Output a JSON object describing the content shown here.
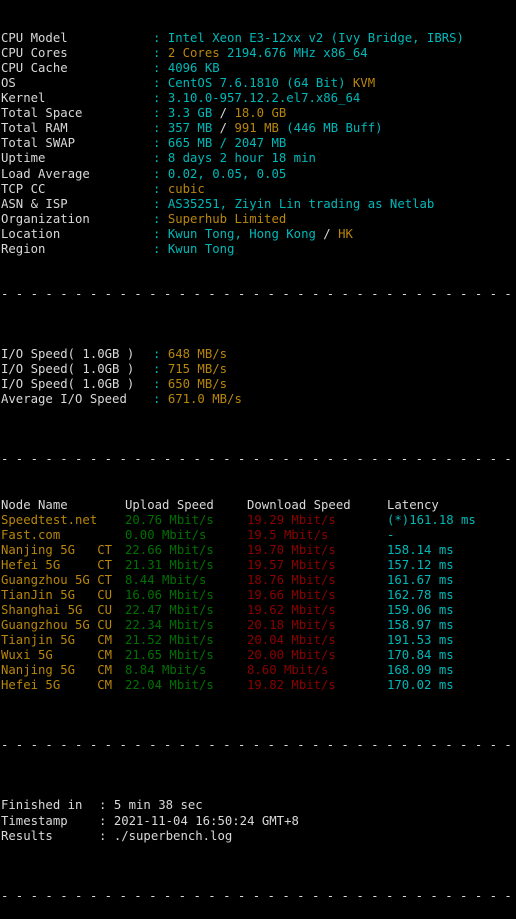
{
  "terminal": {
    "background": "#000000",
    "colors": {
      "white": "#d9d9d9",
      "cyan": "#00b8b8",
      "yellow": "#b8860b",
      "green": "#007000",
      "red": "#8b0000"
    },
    "separator": "----------------------------------------------------------------------"
  },
  "sysinfo": {
    "rows": [
      {
        "label": "CPU Model",
        "colon": ":",
        "value_primary": "Intel Xeon E3-12xx v2 (Ivy Bridge, IBRS)",
        "value_primary_color": "cyan",
        "value_secondary": "",
        "value_secondary_color": ""
      },
      {
        "label": "CPU Cores",
        "colon": ":",
        "value_primary": "2 Cores",
        "value_primary_color": "yellow",
        "value_secondary": "2194.676 MHz x86_64",
        "value_secondary_color": "cyan"
      },
      {
        "label": "CPU Cache",
        "colon": ":",
        "value_primary": "4096 KB",
        "value_primary_color": "cyan",
        "value_secondary": "",
        "value_secondary_color": ""
      },
      {
        "label": "OS",
        "colon": ":",
        "value_primary": "CentOS 7.6.1810 (64 Bit)",
        "value_primary_color": "cyan",
        "value_secondary": "KVM",
        "value_secondary_color": "yellow"
      },
      {
        "label": "Kernel",
        "colon": ":",
        "value_primary": "3.10.0-957.12.2.el7.x86_64",
        "value_primary_color": "cyan",
        "value_secondary": "",
        "value_secondary_color": ""
      },
      {
        "label": "Total Space",
        "colon": ":",
        "value_primary": "3.3 GB",
        "value_primary_color": "cyan",
        "value_secondary": "/ 18.0 GB",
        "value_secondary_color": "yellow"
      },
      {
        "label": "Total RAM",
        "colon": ":",
        "value_primary": "357 MB",
        "value_primary_color": "cyan",
        "value_secondary": "/ 991 MB (446 MB Buff)",
        "value_secondary_color": "yellow-cyan"
      },
      {
        "label": "Total SWAP",
        "colon": ":",
        "value_primary": "665 MB / 2047 MB",
        "value_primary_color": "cyan",
        "value_secondary": "",
        "value_secondary_color": ""
      },
      {
        "label": "Uptime",
        "colon": ":",
        "value_primary": "8 days 2 hour 18 min",
        "value_primary_color": "cyan",
        "value_secondary": "",
        "value_secondary_color": ""
      },
      {
        "label": "Load Average",
        "colon": ":",
        "value_primary": "0.02, 0.05, 0.05",
        "value_primary_color": "cyan",
        "value_secondary": "",
        "value_secondary_color": ""
      },
      {
        "label": "TCP CC",
        "colon": ":",
        "value_primary": "cubic",
        "value_primary_color": "yellow",
        "value_secondary": "",
        "value_secondary_color": ""
      },
      {
        "label": "ASN & ISP",
        "colon": ":",
        "value_primary": "AS35251, Ziyin Lin trading as Netlab",
        "value_primary_color": "cyan",
        "value_secondary": "",
        "value_secondary_color": ""
      },
      {
        "label": "Organization",
        "colon": ":",
        "value_primary": "Superhub Limited",
        "value_primary_color": "yellow",
        "value_secondary": "",
        "value_secondary_color": ""
      },
      {
        "label": "Location",
        "colon": ":",
        "value_primary": "Kwun Tong, Hong Kong",
        "value_primary_color": "cyan",
        "value_secondary": "/ HK",
        "value_secondary_color": "yellow"
      },
      {
        "label": "Region",
        "colon": ":",
        "value_primary": "Kwun Tong",
        "value_primary_color": "cyan",
        "value_secondary": "",
        "value_secondary_color": ""
      }
    ]
  },
  "io": {
    "rows": [
      {
        "label": "I/O Speed( 1.0GB )",
        "colon": ":",
        "value": "648 MB/s"
      },
      {
        "label": "I/O Speed( 1.0GB )",
        "colon": ":",
        "value": "715 MB/s"
      },
      {
        "label": "I/O Speed( 1.0GB )",
        "colon": ":",
        "value": "650 MB/s"
      },
      {
        "label": "Average I/O Speed",
        "colon": ":",
        "value": "671.0 MB/s"
      }
    ]
  },
  "speedtest": {
    "headers": {
      "node": "Node Name",
      "upload": "Upload Speed",
      "download": "Download Speed",
      "latency": "Latency"
    },
    "rows": [
      {
        "node": "Speedtest.net",
        "isp": "",
        "upload": "20.76 Mbit/s",
        "download": "19.29 Mbit/s",
        "latency": "(*)161.18 ms"
      },
      {
        "node": "Fast.com",
        "isp": "",
        "upload": "0.00 Mbit/s",
        "download": "19.5 Mbit/s",
        "latency": "-"
      },
      {
        "node": "Nanjing 5G",
        "isp": "CT",
        "upload": "22.66 Mbit/s",
        "download": "19.70 Mbit/s",
        "latency": "158.14 ms"
      },
      {
        "node": "Hefei 5G",
        "isp": "CT",
        "upload": "21.31 Mbit/s",
        "download": "19.57 Mbit/s",
        "latency": "157.12 ms"
      },
      {
        "node": "Guangzhou 5G",
        "isp": "CT",
        "upload": "8.44 Mbit/s",
        "download": "18.76 Mbit/s",
        "latency": "161.67 ms"
      },
      {
        "node": "TianJin 5G",
        "isp": "CU",
        "upload": "16.06 Mbit/s",
        "download": "19.66 Mbit/s",
        "latency": "162.78 ms"
      },
      {
        "node": "Shanghai 5G",
        "isp": "CU",
        "upload": "22.47 Mbit/s",
        "download": "19.62 Mbit/s",
        "latency": "159.06 ms"
      },
      {
        "node": "Guangzhou 5G",
        "isp": "CU",
        "upload": "22.34 Mbit/s",
        "download": "20.18 Mbit/s",
        "latency": "158.97 ms"
      },
      {
        "node": "Tianjin 5G",
        "isp": "CM",
        "upload": "21.52 Mbit/s",
        "download": "20.04 Mbit/s",
        "latency": "191.53 ms"
      },
      {
        "node": "Wuxi 5G",
        "isp": "CM",
        "upload": "21.65 Mbit/s",
        "download": "20.00 Mbit/s",
        "latency": "170.84 ms"
      },
      {
        "node": "Nanjing 5G",
        "isp": "CM",
        "upload": "8.84 Mbit/s",
        "download": "8.60 Mbit/s",
        "latency": "168.09 ms"
      },
      {
        "node": "Hefei 5G",
        "isp": "CM",
        "upload": "22.04 Mbit/s",
        "download": "19.82 Mbit/s",
        "latency": "170.02 ms"
      }
    ]
  },
  "footer": {
    "rows": [
      {
        "label": "Finished in",
        "colon": ":",
        "value": "5 min 38 sec"
      },
      {
        "label": "Timestamp",
        "colon": ":",
        "value": "2021-11-04 16:50:24 GMT+8"
      },
      {
        "label": "Results",
        "colon": ":",
        "value": "./superbench.log"
      }
    ]
  }
}
